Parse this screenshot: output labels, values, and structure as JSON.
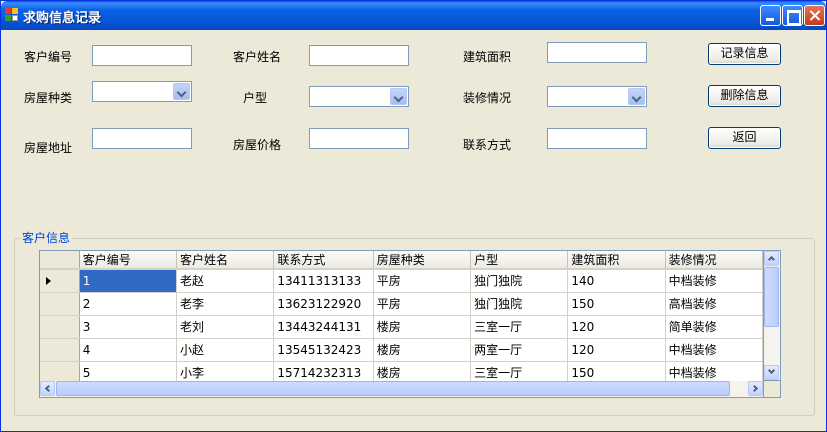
{
  "window": {
    "title": "求购信息记录",
    "titlebar_color": "#0558d8"
  },
  "form": {
    "customer_id_label": "客户编号",
    "customer_name_label": "客户姓名",
    "area_label": "建筑面积",
    "house_type_label": "房屋种类",
    "layout_label": "户型",
    "decoration_label": "装修情况",
    "address_label": "房屋地址",
    "price_label": "房屋价格",
    "contact_label": "联系方式",
    "customer_id_value": "",
    "customer_name_value": "",
    "area_value": "",
    "house_type_value": "",
    "layout_value": "",
    "decoration_value": "",
    "address_value": "",
    "price_value": "",
    "contact_value": ""
  },
  "buttons": {
    "record": "记录信息",
    "delete": "删除信息",
    "back": "返回"
  },
  "group": {
    "title": "客户信息"
  },
  "grid": {
    "columns": [
      "客户编号",
      "客户姓名",
      "联系方式",
      "房屋种类",
      "户型",
      "建筑面积",
      "装修情况"
    ],
    "rows": [
      [
        "1",
        "老赵",
        "13411313133",
        "平房",
        "独门独院",
        "140",
        "中档装修"
      ],
      [
        "2",
        "老李",
        "13623122920",
        "平房",
        "独门独院",
        "150",
        "高档装修"
      ],
      [
        "3",
        "老刘",
        "13443244131",
        "楼房",
        "三室一厅",
        "120",
        "简单装修"
      ],
      [
        "4",
        "小赵",
        "13545132423",
        "楼房",
        "两室一厅",
        "120",
        "中档装修"
      ],
      [
        "5",
        "小李",
        "15714232313",
        "楼房",
        "三室一厅",
        "150",
        "中档装修"
      ]
    ],
    "selected_row": 0,
    "selection_color": "#316ac5"
  },
  "icons": {
    "app": "app-window-icon",
    "minimize": "minimize-icon",
    "maximize": "maximize-icon",
    "close": "close-icon"
  }
}
